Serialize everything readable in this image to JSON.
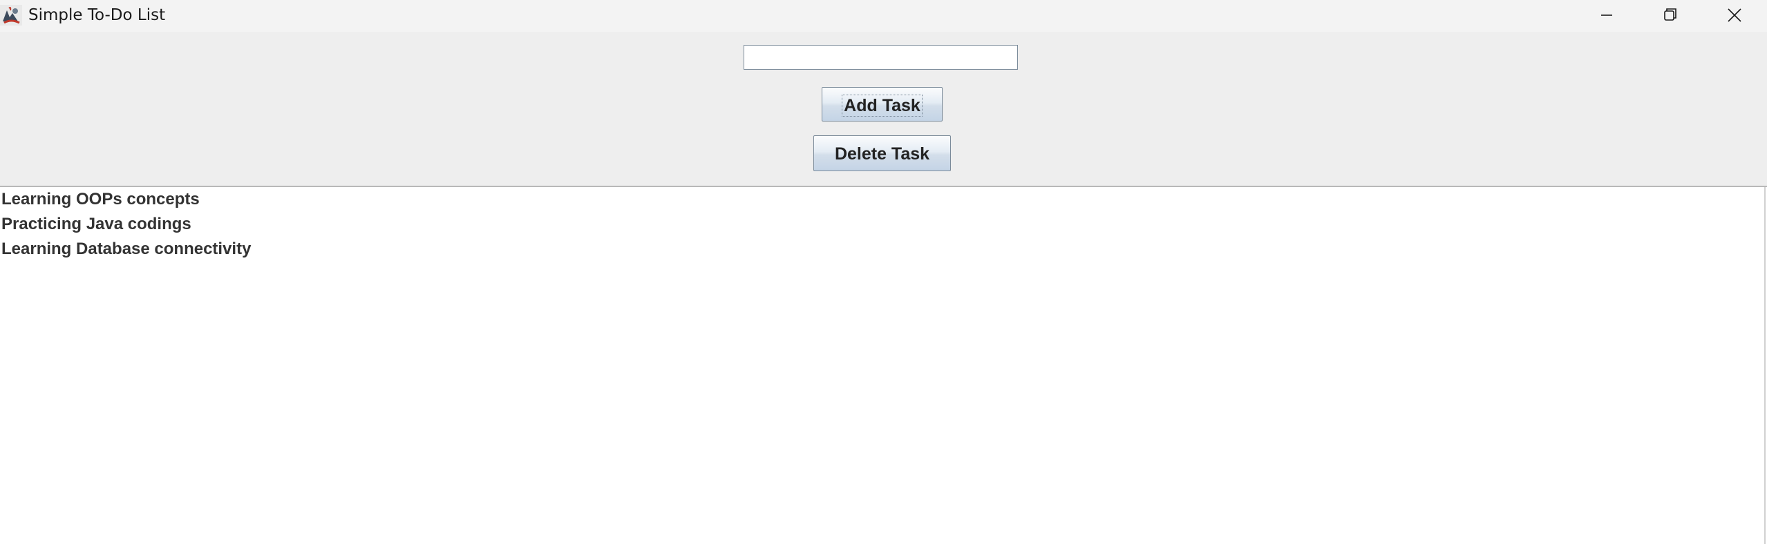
{
  "window": {
    "title": "Simple To-Do List",
    "icon": "java-app-icon",
    "controls": {
      "minimize_icon": "minimize-icon",
      "maximize_icon": "restore-icon",
      "close_icon": "close-icon"
    }
  },
  "form": {
    "task_input_value": "",
    "task_input_placeholder": "",
    "add_label": "Add Task",
    "delete_label": "Delete Task"
  },
  "tasks": [
    "Learning OOPs concepts",
    "Practicing Java codings",
    "Learning Database connectivity"
  ],
  "colors": {
    "titlebar": "#f3f3f3",
    "panel": "#eeeeee",
    "button_gradient_top": "#fbfcfd",
    "button_gradient_bottom": "#c4d4e6",
    "button_border": "#7a8a99",
    "list_background": "#ffffff",
    "text": "#333333"
  }
}
